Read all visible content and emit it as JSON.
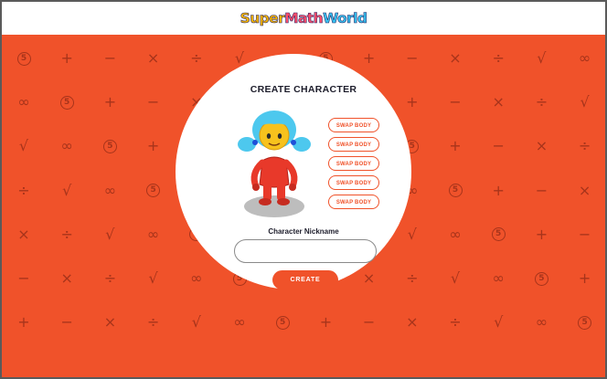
{
  "header": {
    "logo_part1": "Super",
    "logo_part2": "Math",
    "logo_part3": "World"
  },
  "background": {
    "symbols": [
      [
        "⑤",
        "+",
        "−",
        "×",
        "÷",
        "√",
        "∞",
        "⑤",
        "+",
        "−",
        "×",
        "÷",
        "√",
        "∞"
      ],
      [
        "∞",
        "⑤",
        "+",
        "−",
        "×",
        "÷",
        "√",
        "∞",
        "⑤",
        "+",
        "−",
        "×",
        "÷",
        "√"
      ],
      [
        "√",
        "∞",
        "⑤",
        "+",
        "−",
        "×",
        "÷",
        "√",
        "∞",
        "⑤",
        "+",
        "−",
        "×",
        "÷"
      ],
      [
        "÷",
        "√",
        "∞",
        "⑤",
        "+",
        "−",
        "×",
        "÷",
        "√",
        "∞",
        "⑤",
        "+",
        "−",
        "×"
      ],
      [
        "×",
        "÷",
        "√",
        "∞",
        "⑤",
        "+",
        "−",
        "×",
        "÷",
        "√",
        "∞",
        "⑤",
        "+",
        "−"
      ],
      [
        "−",
        "×",
        "÷",
        "√",
        "∞",
        "⑤",
        "+",
        "−",
        "×",
        "÷",
        "√",
        "∞",
        "⑤",
        "+"
      ],
      [
        "+",
        "−",
        "×",
        "÷",
        "√",
        "∞",
        "⑤",
        "+",
        "−",
        "×",
        "÷",
        "√",
        "∞",
        "⑤"
      ]
    ]
  },
  "panel": {
    "title": "CREATE CHARACTER",
    "swap_buttons": [
      "SWAP BODY",
      "SWAP BODY",
      "SWAP BODY",
      "SWAP BODY",
      "SWAP BODY"
    ],
    "nickname_label": "Character Nickname",
    "nickname_value": "",
    "nickname_placeholder": "",
    "create_label": "CREATE"
  },
  "colors": {
    "brand_orange": "#f0522a",
    "pattern": "#a7341b",
    "hair": "#4dc8ee",
    "face": "#f7c21d",
    "body": "#e8392a"
  }
}
